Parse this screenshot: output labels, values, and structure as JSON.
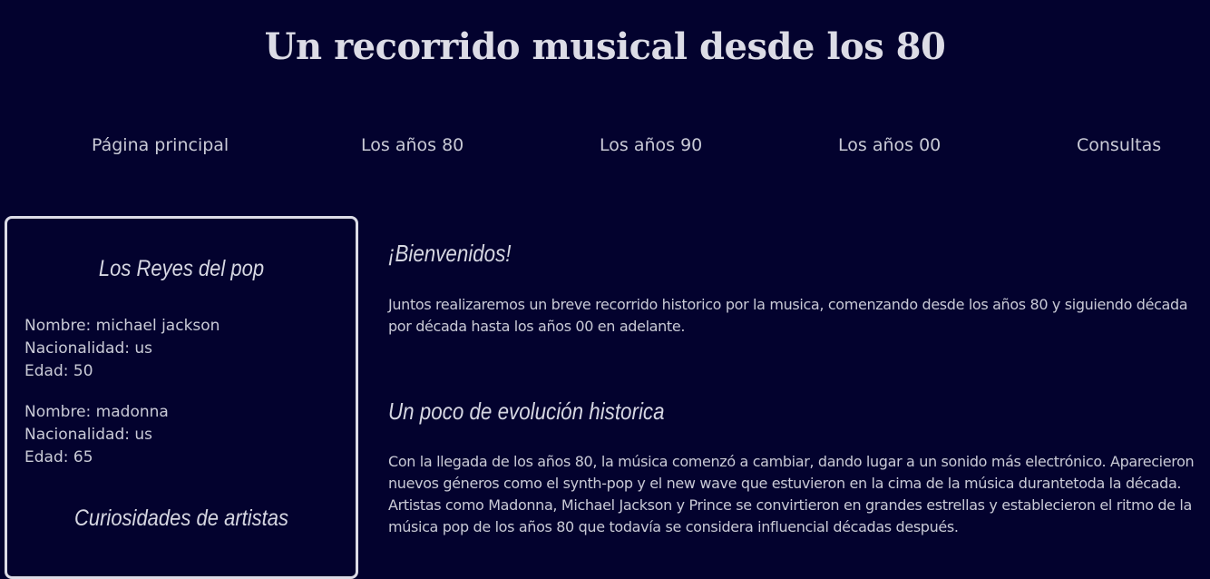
{
  "header": {
    "title": "Un recorrido musical desde los 80"
  },
  "nav": {
    "items": [
      {
        "label": "Página principal"
      },
      {
        "label": "Los años 80"
      },
      {
        "label": "Los años 90"
      },
      {
        "label": "Los años 00"
      },
      {
        "label": "Consultas"
      }
    ]
  },
  "sidebar": {
    "kings_heading": "Los Reyes del pop",
    "artists": [
      {
        "nombre": "Nombre: michael jackson",
        "nacionalidad": "Nacionalidad: us",
        "edad": "Edad: 50"
      },
      {
        "nombre": "Nombre: madonna",
        "nacionalidad": "Nacionalidad: us",
        "edad": "Edad: 65"
      }
    ],
    "curiosities_heading": "Curiosidades de artistas"
  },
  "main": {
    "welcome_heading": "¡Bienvenidos!",
    "welcome_text": "Juntos realizaremos un breve recorrido historico por la musica, comenzando desde los años 80 y siguiendo década por década hasta los años 00 en adelante.",
    "history_heading": "Un poco de evolución historica",
    "history_text": "Con la llegada de los años 80, la música comenzó a cambiar, dando lugar a un sonido más electrónico. Aparecieron nuevos géneros como el synth-pop y el new wave que estuvieron en la cima de la música durantetoda la década. Artistas como Madonna, Michael Jackson y Prince se convirtieron en grandes estrellas y establecieron el ritmo de la música pop de los años 80 que todavía se considera influencial décadas después."
  },
  "colors": {
    "background": "#03022e",
    "text": "#c9cad6",
    "heading": "#dcdce6",
    "border": "#dcdce6"
  }
}
